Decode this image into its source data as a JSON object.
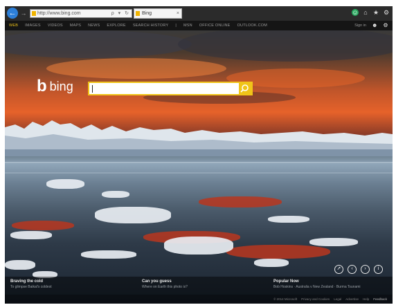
{
  "browser": {
    "address_url": "http://www.bing.com",
    "tab_title": "Bing",
    "tab_close": "×",
    "back_arrow": "←",
    "forward_arrow": "→",
    "address_tools": "ρ ▾ ↻",
    "toolbar_icons": [
      "smiley-icon",
      "home-icon",
      "star-icon",
      "gear-icon"
    ]
  },
  "bing_nav": {
    "items": [
      "WEB",
      "IMAGES",
      "VIDEOS",
      "MAPS",
      "NEWS",
      "EXPLORE",
      "SEARCH HISTORY",
      "|",
      "MSN",
      "OFFICE ONLINE",
      "OUTLOOK.COM"
    ],
    "active_index": 0,
    "sign_in": "Sign in",
    "icons": [
      "person-icon",
      "gear-icon"
    ]
  },
  "search": {
    "logo_text": "bing",
    "placeholder": "",
    "accent_color": "#f0c419"
  },
  "hero_controls": [
    "compass-icon",
    "previous-icon",
    "next-icon",
    "info-icon"
  ],
  "stories": [
    {
      "title": "Braving the cold",
      "desc": "To glimpse Baikal's coldest"
    },
    {
      "title": "Can you guess",
      "desc": "Where on Earth this photo is?"
    },
    {
      "title": "Popular Now",
      "desc": "Bob Hoskins · Australia v New Zealand · Burma Tsunami"
    }
  ],
  "footer_links": [
    "© 2014 Microsoft",
    "Privacy and Cookies",
    "Legal",
    "Advertise",
    "Help",
    "Feedback"
  ]
}
